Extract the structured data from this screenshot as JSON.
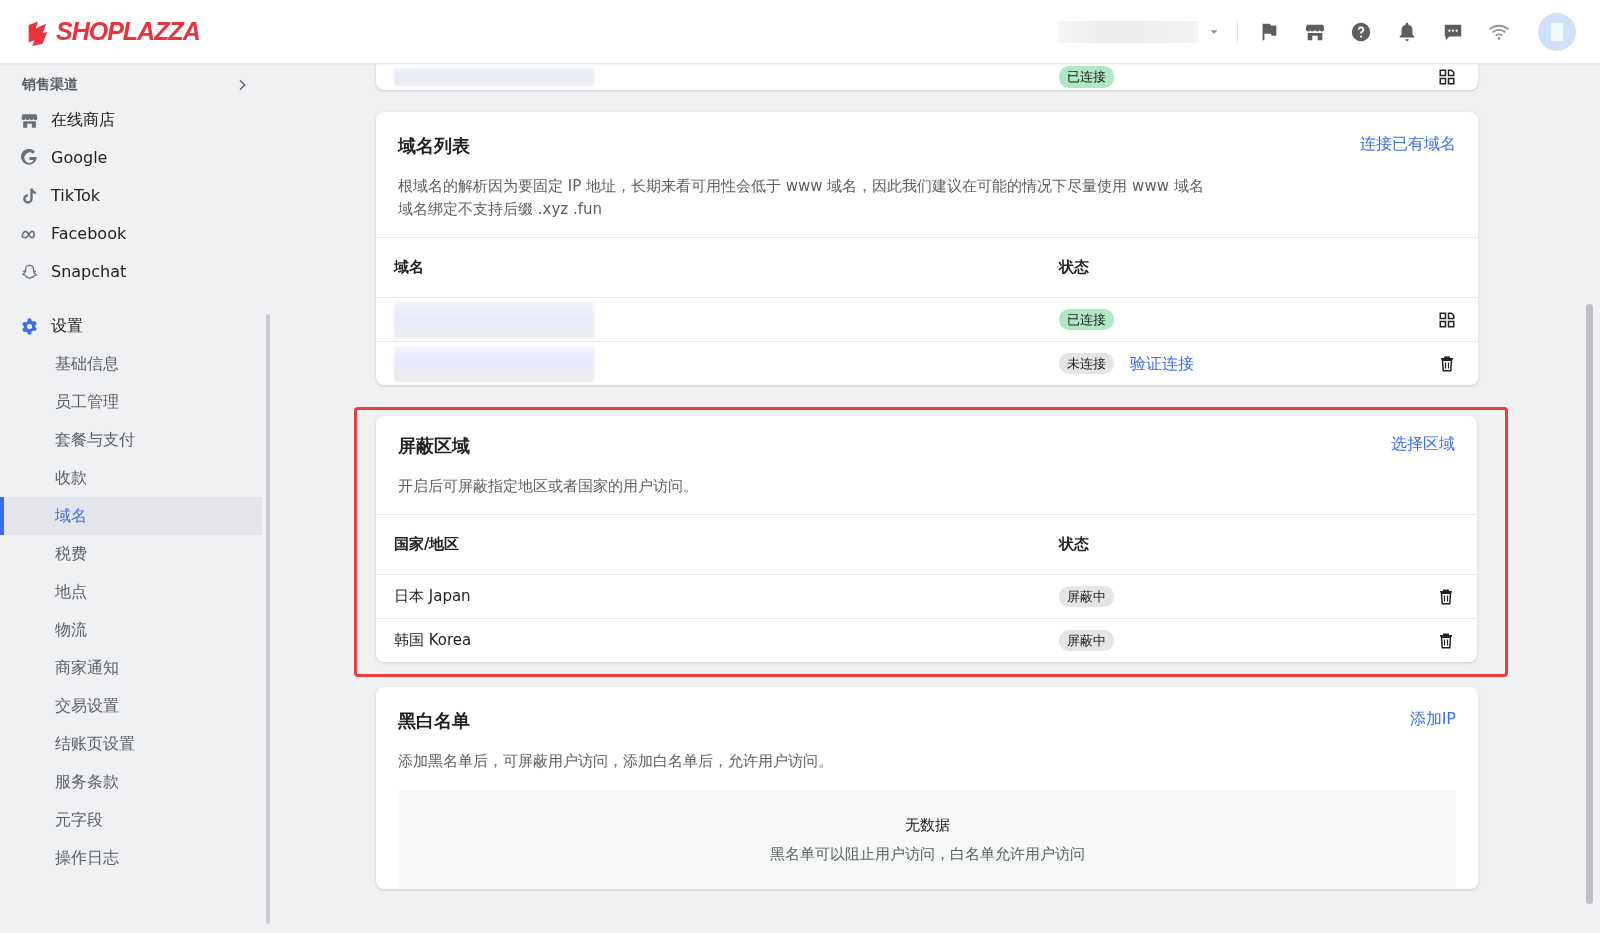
{
  "header": {
    "logo": "SHOPLAZZA"
  },
  "sidebar": {
    "section": {
      "label": "销售渠道"
    },
    "channels": [
      {
        "label": "在线商店"
      },
      {
        "label": "Google"
      },
      {
        "label": "TikTok"
      },
      {
        "label": "Facebook"
      },
      {
        "label": "Snapchat"
      }
    ],
    "settings": {
      "label": "设置",
      "items": [
        {
          "label": "基础信息",
          "selected": false
        },
        {
          "label": "员工管理",
          "selected": false
        },
        {
          "label": "套餐与支付",
          "selected": false
        },
        {
          "label": "收款",
          "selected": false
        },
        {
          "label": "域名",
          "selected": true
        },
        {
          "label": "税费",
          "selected": false
        },
        {
          "label": "地点",
          "selected": false
        },
        {
          "label": "物流",
          "selected": false
        },
        {
          "label": "商家通知",
          "selected": false
        },
        {
          "label": "交易设置",
          "selected": false
        },
        {
          "label": "结账页设置",
          "selected": false
        },
        {
          "label": "服务条款",
          "selected": false
        },
        {
          "label": "元字段",
          "selected": false
        },
        {
          "label": "操作日志",
          "selected": false
        }
      ]
    }
  },
  "top_card": {
    "rows": [
      {
        "status": "已连接",
        "connected": true
      }
    ]
  },
  "domain_list": {
    "title": "域名列表",
    "link": "连接已有域名",
    "description": [
      "根域名的解析因为要固定 IP 地址，长期来看可用性会低于 www 域名，因此我们建议在可能的情况下尽量使用 www 域名",
      "域名绑定不支持后缀 .xyz .fun"
    ],
    "columns": [
      "域名",
      "状态"
    ],
    "rows": [
      {
        "status": "已连接",
        "connected": true
      },
      {
        "status": "未连接",
        "connected": false,
        "verify": "验证连接"
      }
    ]
  },
  "blocked_regions": {
    "highlighted": true,
    "title": "屏蔽区域",
    "link": "选择区域",
    "description": "开启后可屏蔽指定地区或者国家的用户访问。",
    "columns": [
      "国家/地区",
      "状态"
    ],
    "rows": [
      {
        "region": "日本 Japan",
        "status": "屏蔽中"
      },
      {
        "region": "韩国 Korea",
        "status": "屏蔽中"
      }
    ]
  },
  "ip_list": {
    "title": "黑白名单",
    "link": "添加IP",
    "description": "添加黑名单后，可屏蔽用户访问，添加白名单后，允许用户访问。",
    "empty": {
      "title": "无数据",
      "text": "黑名单可以阻止用户访问，白名单允许用户访问"
    }
  }
}
